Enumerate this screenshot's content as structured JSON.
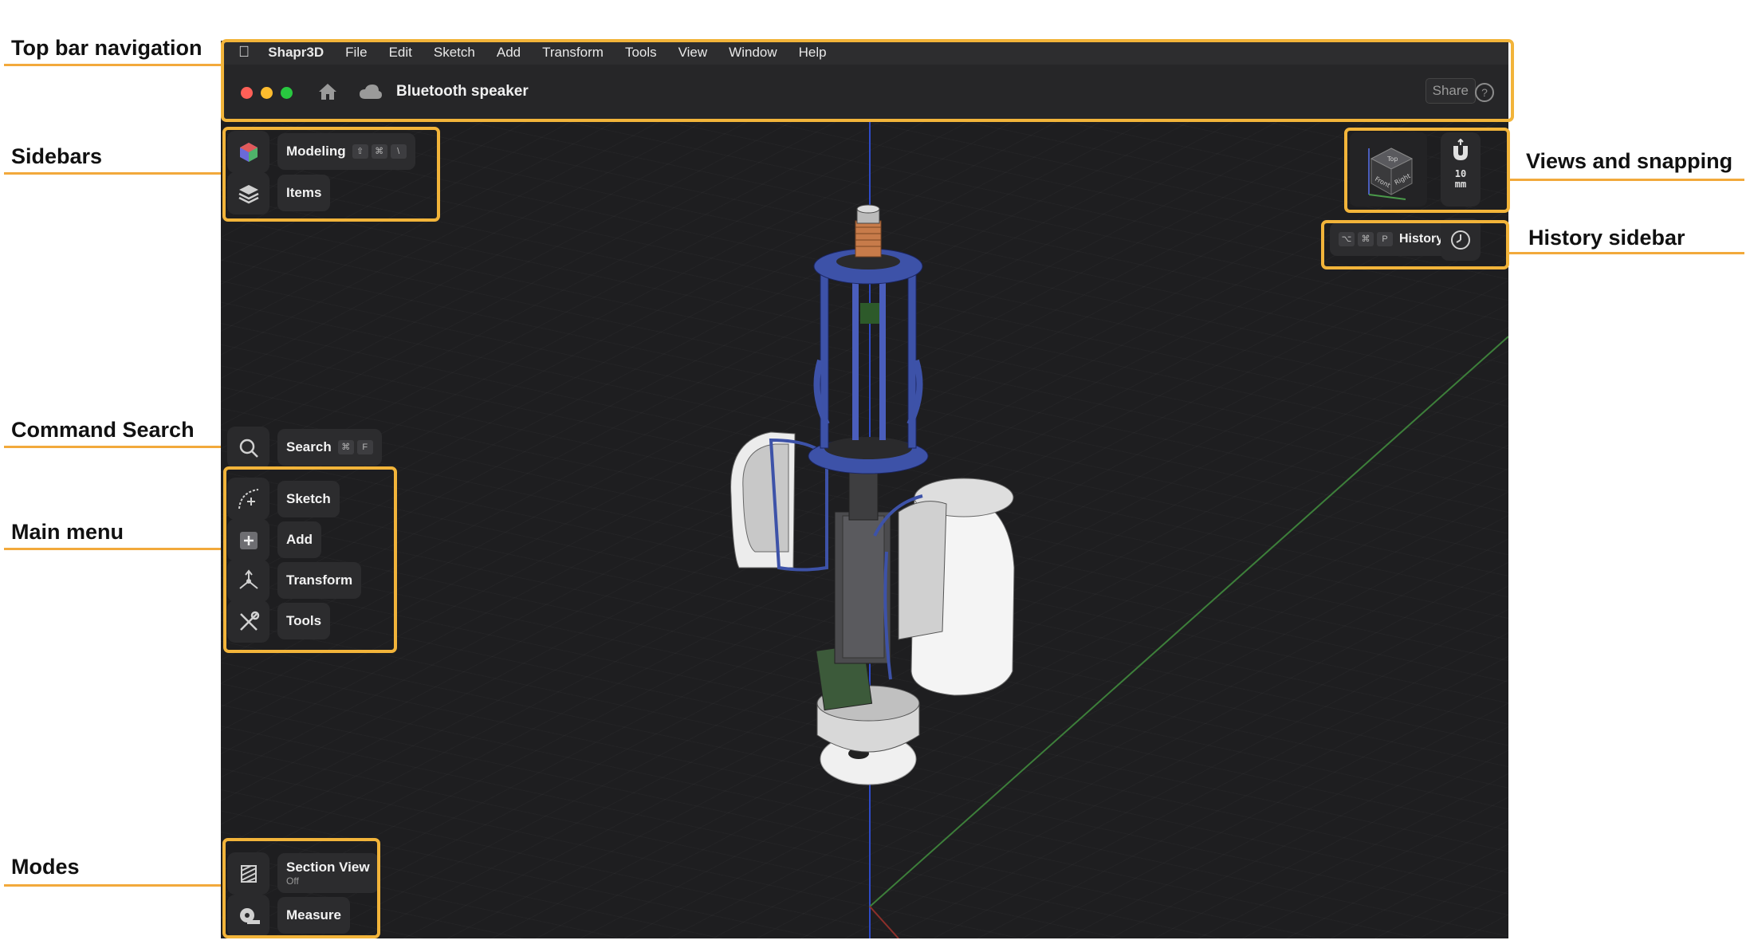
{
  "annotations": {
    "top_bar": "Top bar navigation",
    "sidebars": "Sidebars",
    "command_search": "Command Search",
    "main_menu": "Main menu",
    "modes": "Modes",
    "views_snapping": "Views and snapping",
    "history_sidebar": "History sidebar"
  },
  "menubar": {
    "app_name": "Shapr3D",
    "items": [
      "File",
      "Edit",
      "Sketch",
      "Add",
      "Transform",
      "Tools",
      "View",
      "Window",
      "Help"
    ]
  },
  "titlebar": {
    "doc_title": "Bluetooth speaker",
    "share": "Share",
    "help": "?"
  },
  "sidebar": {
    "modeling": "Modeling",
    "modeling_keys": [
      "⇧",
      "⌘",
      "\\"
    ],
    "items": "Items"
  },
  "search": {
    "label": "Search",
    "keys": [
      "⌘",
      "F"
    ]
  },
  "main_menu": {
    "sketch": "Sketch",
    "add": "Add",
    "transform": "Transform",
    "tools": "Tools"
  },
  "modes": {
    "section_view": "Section View",
    "section_view_state": "Off",
    "measure": "Measure"
  },
  "views": {
    "cube_top": "Top",
    "cube_front": "Front",
    "cube_right": "Right",
    "snap_value": "10",
    "snap_unit": "mm"
  },
  "history": {
    "label": "History",
    "keys": [
      "⌥",
      "⌘",
      "P"
    ]
  },
  "colors": {
    "accent_annotation": "#f2b43a",
    "model_blue": "#3d52a8",
    "close": "#ff5f57",
    "minimize": "#febc2e",
    "zoom": "#28c840"
  }
}
